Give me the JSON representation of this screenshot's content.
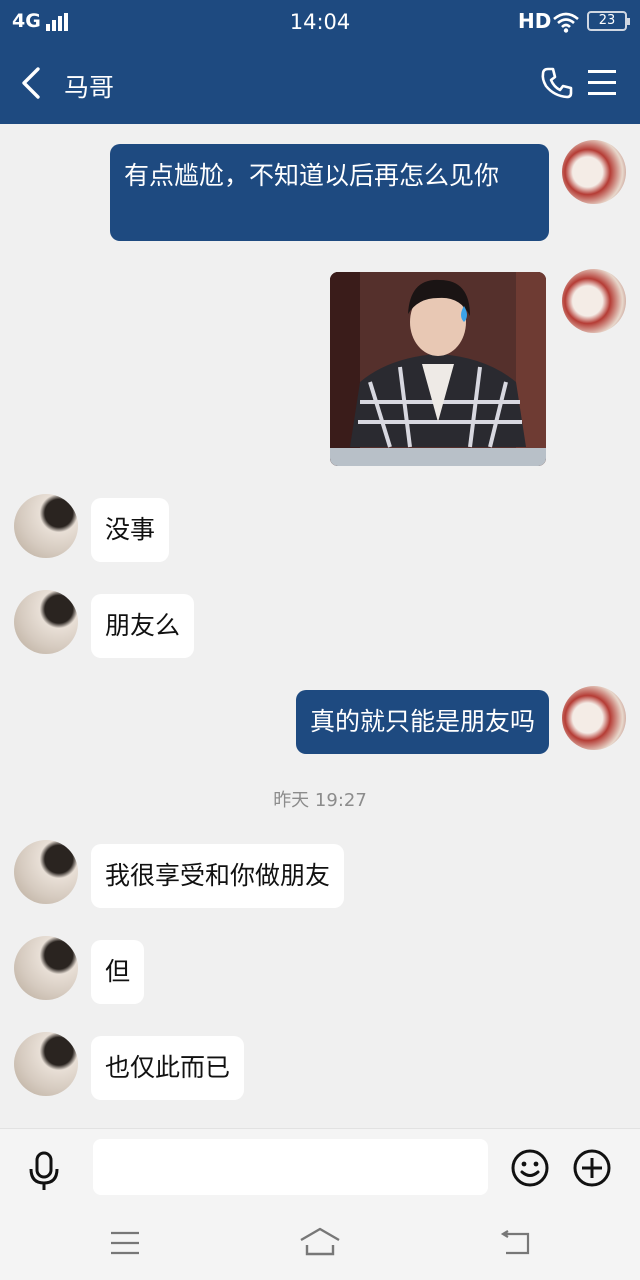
{
  "status_bar": {
    "network": "4G",
    "time": "14:04",
    "hd": "HD",
    "battery": "23"
  },
  "header": {
    "title": "马哥"
  },
  "messages": [
    {
      "side": "right",
      "text": "有点尴尬，不知道以后再怎么见你"
    },
    {
      "side": "right",
      "type": "image",
      "icon": "sweat-drop-emoji"
    },
    {
      "side": "left",
      "text": "没事"
    },
    {
      "side": "left",
      "text": "朋友么"
    },
    {
      "side": "right",
      "text": "真的就只能是朋友吗"
    },
    {
      "side": "left",
      "text": "我很享受和你做朋友"
    },
    {
      "side": "left",
      "text": "但"
    },
    {
      "side": "left",
      "text": "也仅此而已"
    }
  ],
  "timestamp": "昨天 19:27",
  "input": {
    "value": "",
    "placeholder": ""
  },
  "icons": {
    "back": "chevron-left-icon",
    "call": "phone-icon",
    "menu": "hamburger-menu-icon",
    "voice": "microphone-icon",
    "emoji": "smiley-icon",
    "more": "plus-circle-icon"
  },
  "colors": {
    "brand": "#1e4a80",
    "background": "#f0f0f0",
    "incoming_bubble": "#ffffff",
    "timestamp": "#8c8c8c"
  }
}
